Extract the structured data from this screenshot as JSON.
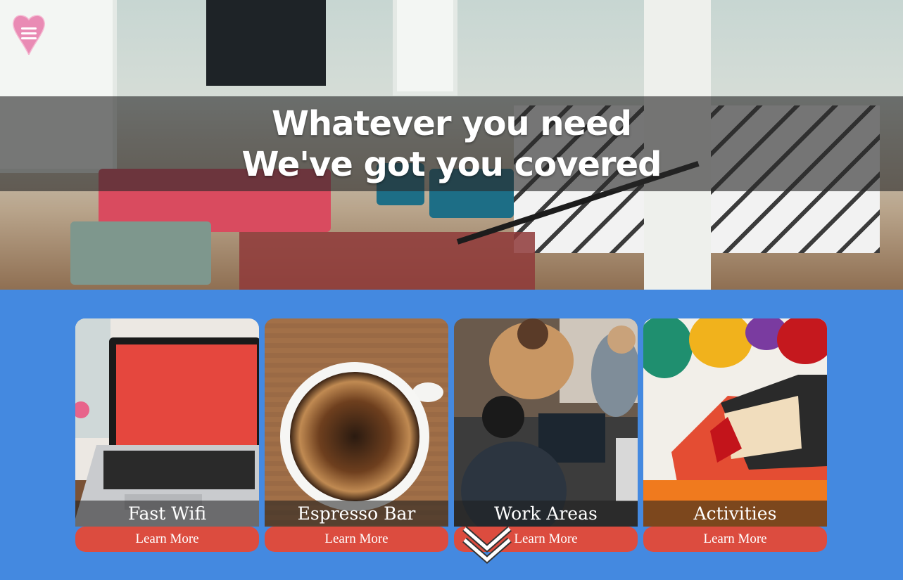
{
  "hero": {
    "headline_line1": "Whatever you need",
    "headline_line2": "We've got you covered"
  },
  "nav": {
    "menu_icon": "hamburger-menu-icon",
    "badge_shape": "heart"
  },
  "cards": [
    {
      "title": "Fast Wifi",
      "button_label": "Learn More",
      "image": "laptop-photo"
    },
    {
      "title": "Espresso Bar",
      "button_label": "Learn More",
      "image": "coffee-cup-photo"
    },
    {
      "title": "Work Areas",
      "button_label": "Learn More",
      "image": "coworkers-photo"
    },
    {
      "title": "Activities",
      "button_label": "Learn More",
      "image": "paint-brush-photo"
    }
  ],
  "scroll_indicator": {
    "icon": "double-chevron-down-icon"
  },
  "colors": {
    "page_background": "#4489e0",
    "button": "#dc4c3f",
    "menu_badge": "#e98bb4",
    "hero_overlay": "rgba(40,40,40,0.62)"
  }
}
